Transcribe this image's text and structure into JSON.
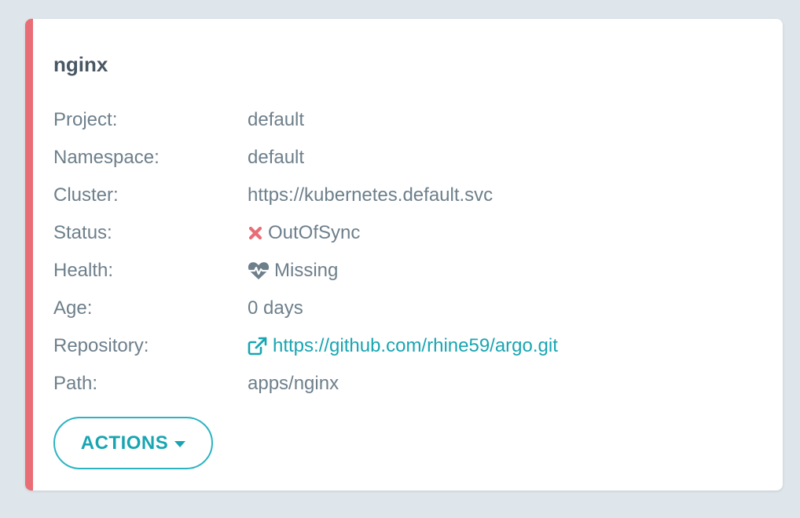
{
  "colors": {
    "background": "#dee6eb",
    "card": "#ffffff",
    "status_stripe": "#e96d76",
    "title": "#495763",
    "text": "#6d7f8b",
    "accent": "#18a5b2",
    "out_of_sync_icon": "#e96d76",
    "health_icon": "#6d7f8b"
  },
  "app": {
    "name": "nginx"
  },
  "fields": {
    "project": {
      "label": "Project:",
      "value": "default"
    },
    "namespace": {
      "label": "Namespace:",
      "value": "default"
    },
    "cluster": {
      "label": "Cluster:",
      "value": "https://kubernetes.default.svc"
    },
    "status": {
      "label": "Status:",
      "value": "OutOfSync",
      "icon": "times-icon"
    },
    "health": {
      "label": "Health:",
      "value": "Missing",
      "icon": "heartbeat-icon"
    },
    "age": {
      "label": "Age:",
      "value": "0 days"
    },
    "repository": {
      "label": "Repository:",
      "value": "https://github.com/rhine59/argo.git",
      "icon": "external-link-icon"
    },
    "path": {
      "label": "Path:",
      "value": "apps/nginx"
    }
  },
  "actions": {
    "label": "ACTIONS",
    "icon": "caret-down-icon"
  }
}
